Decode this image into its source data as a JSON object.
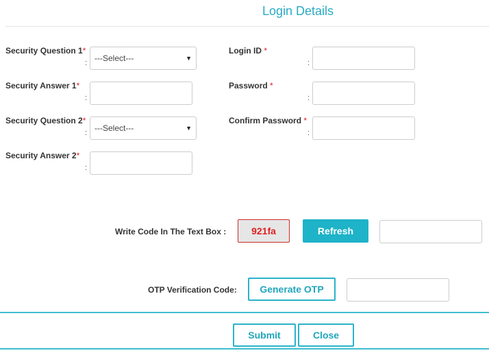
{
  "page": {
    "title": "Login Details"
  },
  "form": {
    "required_mark": "*",
    "colon": ":",
    "security_question_1": {
      "label": "Security Question 1",
      "selected": "---Select---"
    },
    "security_answer_1": {
      "label": "Security Answer 1",
      "value": ""
    },
    "security_question_2": {
      "label": "Security Question 2",
      "selected": "---Select---"
    },
    "security_answer_2": {
      "label": "Security Answer 2",
      "value": ""
    },
    "login_id": {
      "label": "Login ID",
      "value": ""
    },
    "password": {
      "label": "Password",
      "value": ""
    },
    "confirm_password": {
      "label": "Confirm Password",
      "value": ""
    }
  },
  "captcha": {
    "label": "Write Code In The Text Box :",
    "code": "921fa",
    "refresh_label": "Refresh",
    "input_value": ""
  },
  "otp": {
    "label": "OTP Verification Code:",
    "generate_label": "Generate OTP",
    "input_value": ""
  },
  "actions": {
    "submit_label": "Submit",
    "close_label": "Close"
  },
  "icons": {
    "select_caret": "caret-down-icon"
  },
  "colors": {
    "accent": "#29abc4",
    "button_fill": "#1eb3c8",
    "required": "#e02020",
    "captcha_border": "#cc2b2b"
  }
}
